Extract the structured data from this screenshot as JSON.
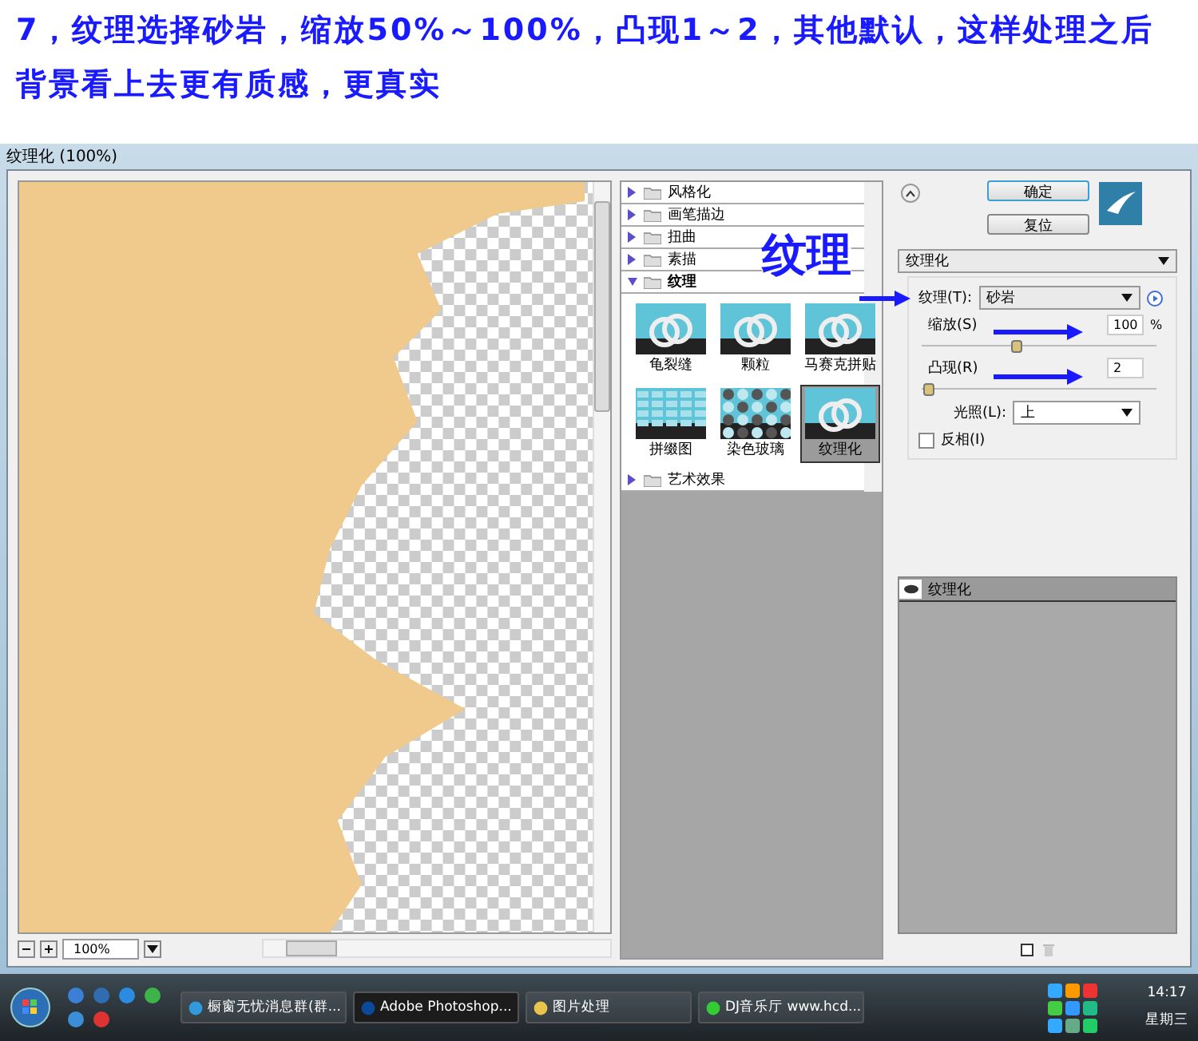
{
  "caption": {
    "lines": [
      "7，纹理选择砂岩，缩放50%～100%，凸现1～2，其他默认，这样处理之后",
      "背景看上去更有质感，更真实"
    ]
  },
  "window": {
    "title": "纹理化 (100%)"
  },
  "preview": {
    "zoom": "100%"
  },
  "filter_groups": [
    {
      "label": "风格化",
      "expanded": false
    },
    {
      "label": "画笔描边",
      "expanded": false
    },
    {
      "label": "扭曲",
      "expanded": false
    },
    {
      "label": "素描",
      "expanded": false
    },
    {
      "label": "纹理",
      "expanded": true,
      "items": [
        {
          "label": "龟裂缝",
          "selected": false
        },
        {
          "label": "颗粒",
          "selected": false
        },
        {
          "label": "马赛克拼贴",
          "selected": false
        },
        {
          "label": "拼缀图",
          "selected": false
        },
        {
          "label": "染色玻璃",
          "selected": false
        },
        {
          "label": "纹理化",
          "selected": true
        }
      ]
    },
    {
      "label": "艺术效果",
      "expanded": false
    }
  ],
  "buttons": [
    {
      "label": "确定",
      "default": true
    },
    {
      "label": "复位",
      "default": false
    }
  ],
  "filter_select": "纹理化",
  "settings": {
    "texture": {
      "label": "纹理(T):",
      "value": "砂岩"
    },
    "scaling": {
      "label": "缩放(S)",
      "value": "100",
      "unit": "%",
      "level": 0.4
    },
    "relief": {
      "label": "凸现(R)",
      "value": "2",
      "level": 0.03
    },
    "light": {
      "label": "光照(L):",
      "value": "上"
    },
    "invert": {
      "label": "反相(I)",
      "checked": false
    }
  },
  "layers": [
    {
      "label": "纹理化",
      "visible": true
    }
  ],
  "annotation": {
    "label": "纹理"
  },
  "taskbar": {
    "tasks": [
      {
        "label": "橱窗无忧消息群(群...",
        "selected": false
      },
      {
        "label": "Adobe Photoshop...",
        "selected": true
      },
      {
        "label": "图片处理",
        "selected": false
      },
      {
        "label": "DJ音乐厅 www.hcd...",
        "selected": false
      }
    ],
    "time": "14:17",
    "day": "星期三"
  }
}
